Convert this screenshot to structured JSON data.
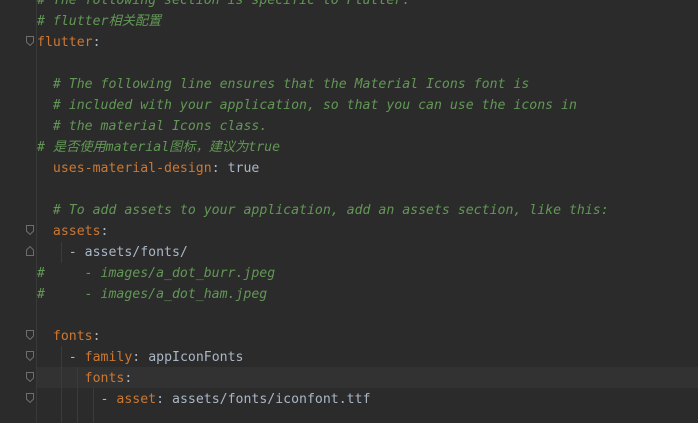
{
  "editor": {
    "lines": [
      {
        "indent": "",
        "parts": [
          {
            "t": "comment",
            "v": "# The following section is specific to Flutter."
          }
        ]
      },
      {
        "indent": "",
        "parts": [
          {
            "t": "comment",
            "v": "# flutter相关配置"
          }
        ]
      },
      {
        "indent": "",
        "parts": [
          {
            "t": "key",
            "v": "flutter"
          },
          {
            "t": "punct",
            "v": ":"
          }
        ]
      },
      {
        "indent": "",
        "parts": []
      },
      {
        "indent": "  ",
        "parts": [
          {
            "t": "comment",
            "v": "# The following line ensures that the Material Icons font is"
          }
        ]
      },
      {
        "indent": "  ",
        "parts": [
          {
            "t": "comment",
            "v": "# included with your application, so that you can use the icons in"
          }
        ]
      },
      {
        "indent": "  ",
        "parts": [
          {
            "t": "comment",
            "v": "# the material Icons class."
          }
        ]
      },
      {
        "indent": "",
        "parts": [
          {
            "t": "comment",
            "v": "# 是否使用material图标，建议为true"
          }
        ]
      },
      {
        "indent": "  ",
        "parts": [
          {
            "t": "key",
            "v": "uses-material-design"
          },
          {
            "t": "punct",
            "v": ": "
          },
          {
            "t": "val",
            "v": "true"
          }
        ]
      },
      {
        "indent": "",
        "parts": []
      },
      {
        "indent": "  ",
        "parts": [
          {
            "t": "comment",
            "v": "# To add assets to your application, add an assets section, like this:"
          }
        ]
      },
      {
        "indent": "  ",
        "parts": [
          {
            "t": "key",
            "v": "assets"
          },
          {
            "t": "punct",
            "v": ":"
          }
        ]
      },
      {
        "indent": "    ",
        "parts": [
          {
            "t": "punct",
            "v": "- "
          },
          {
            "t": "val",
            "v": "assets/fonts/"
          }
        ]
      },
      {
        "indent": "",
        "parts": [
          {
            "t": "comment",
            "v": "#     - images/a_dot_burr.jpeg"
          }
        ]
      },
      {
        "indent": "",
        "parts": [
          {
            "t": "comment",
            "v": "#     - images/a_dot_ham.jpeg"
          }
        ]
      },
      {
        "indent": "",
        "parts": []
      },
      {
        "indent": "  ",
        "parts": [
          {
            "t": "key",
            "v": "fonts"
          },
          {
            "t": "punct",
            "v": ":"
          }
        ]
      },
      {
        "indent": "    ",
        "parts": [
          {
            "t": "punct",
            "v": "- "
          },
          {
            "t": "key",
            "v": "family"
          },
          {
            "t": "punct",
            "v": ": "
          },
          {
            "t": "val",
            "v": "appIconFonts"
          }
        ]
      },
      {
        "indent": "      ",
        "parts": [
          {
            "t": "key",
            "v": "fonts"
          },
          {
            "t": "punct",
            "v": ":"
          }
        ]
      },
      {
        "indent": "        ",
        "parts": [
          {
            "t": "punct",
            "v": "- "
          },
          {
            "t": "key",
            "v": "asset"
          },
          {
            "t": "punct",
            "v": ": "
          },
          {
            "t": "val",
            "v": "assets/fonts/iconfont.ttf"
          }
        ]
      },
      {
        "indent": "",
        "parts": []
      }
    ],
    "colors": {
      "background": "#2b2b2b",
      "comment": "#629755",
      "key": "#cc7832",
      "text": "#a9b7c6",
      "current_line": "#323232"
    }
  }
}
